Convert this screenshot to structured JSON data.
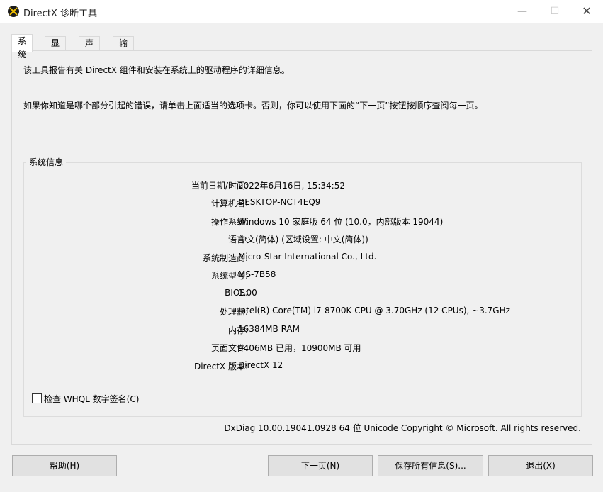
{
  "window": {
    "title": "DirectX 诊断工具",
    "min_glyph": "—",
    "max_glyph": "☐",
    "close_glyph": "✕"
  },
  "tabs": [
    {
      "label": "系统",
      "active": true
    },
    {
      "label": "显示",
      "active": false
    },
    {
      "label": "声音",
      "active": false
    },
    {
      "label": "输入",
      "active": false
    }
  ],
  "intro": {
    "line1": "该工具报告有关 DirectX 组件和安装在系统上的驱动程序的详细信息。",
    "line2": "如果你知道是哪个部分引起的错误，请单击上面适当的选项卡。否则，你可以使用下面的“下一页”按钮按顺序查阅每一页。"
  },
  "system_info": {
    "group_label": "系统信息",
    "rows": [
      {
        "label": "当前日期/时间:",
        "value": "2022年6月16日, 15:34:52"
      },
      {
        "label": "计算机名:",
        "value": "DESKTOP-NCT4EQ9"
      },
      {
        "label": "操作系统:",
        "value": "Windows 10 家庭版 64 位 (10.0，内部版本 19044)"
      },
      {
        "label": "语言:",
        "value": "中文(简体) (区域设置: 中文(简体))"
      },
      {
        "label": "系统制造商:",
        "value": "Micro-Star International Co., Ltd."
      },
      {
        "label": "系统型号:",
        "value": "MS-7B58"
      },
      {
        "label": "BIOS:",
        "value": "1.00"
      },
      {
        "label": "处理器:",
        "value": "Intel(R) Core(TM) i7-8700K CPU @ 3.70GHz (12 CPUs), ~3.7GHz"
      },
      {
        "label": "内存:",
        "value": "16384MB RAM"
      },
      {
        "label": "页面文件:",
        "value": "9406MB 已用，10900MB 可用"
      },
      {
        "label": "DirectX 版本:",
        "value": "DirectX 12"
      }
    ],
    "whql_checkbox": {
      "label": "检查 WHQL 数字签名(C)",
      "checked": false
    }
  },
  "version_line": "DxDiag 10.00.19041.0928 64 位 Unicode  Copyright © Microsoft. All rights reserved.",
  "buttons": {
    "help": "帮助(H)",
    "next": "下一页(N)",
    "save": "保存所有信息(S)...",
    "exit": "退出(X)"
  }
}
